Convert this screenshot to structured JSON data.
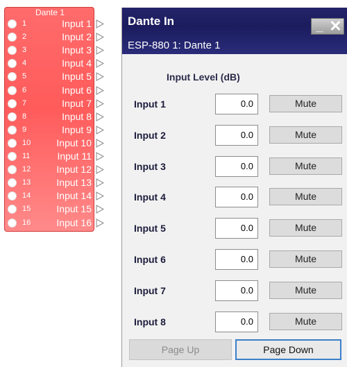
{
  "dante_block": {
    "title": "Dante 1",
    "channels": [
      {
        "num": "1",
        "label": "Input 1"
      },
      {
        "num": "2",
        "label": "Input 2"
      },
      {
        "num": "3",
        "label": "Input 3"
      },
      {
        "num": "4",
        "label": "Input 4"
      },
      {
        "num": "5",
        "label": "Input 5"
      },
      {
        "num": "6",
        "label": "Input 6"
      },
      {
        "num": "7",
        "label": "Input 7"
      },
      {
        "num": "8",
        "label": "Input 8"
      },
      {
        "num": "9",
        "label": "Input 9"
      },
      {
        "num": "10",
        "label": "Input 10"
      },
      {
        "num": "11",
        "label": "Input 11"
      },
      {
        "num": "12",
        "label": "Input 12"
      },
      {
        "num": "13",
        "label": "Input 13"
      },
      {
        "num": "14",
        "label": "Input 14"
      },
      {
        "num": "15",
        "label": "Input 15"
      },
      {
        "num": "16",
        "label": "Input 16"
      }
    ]
  },
  "window": {
    "title": "Dante In",
    "subtitle": "ESP-880 1: Dante 1",
    "controls": {
      "minimize_icon": "minimize-icon",
      "close_icon": "close-icon"
    },
    "header": "Input Level (dB)",
    "inputs": [
      {
        "name": "Input 1",
        "value": "0.0",
        "mute_label": "Mute"
      },
      {
        "name": "Input 2",
        "value": "0.0",
        "mute_label": "Mute"
      },
      {
        "name": "Input 3",
        "value": "0.0",
        "mute_label": "Mute"
      },
      {
        "name": "Input 4",
        "value": "0.0",
        "mute_label": "Mute"
      },
      {
        "name": "Input 5",
        "value": "0.0",
        "mute_label": "Mute"
      },
      {
        "name": "Input 6",
        "value": "0.0",
        "mute_label": "Mute"
      },
      {
        "name": "Input 7",
        "value": "0.0",
        "mute_label": "Mute"
      },
      {
        "name": "Input 8",
        "value": "0.0",
        "mute_label": "Mute"
      }
    ],
    "page_up_label": "Page Up",
    "page_down_label": "Page Down"
  },
  "colors": {
    "block_fill": "#ff5b5b",
    "titlebar": "#1b1c5e",
    "focus_border": "#3c7fc9"
  }
}
